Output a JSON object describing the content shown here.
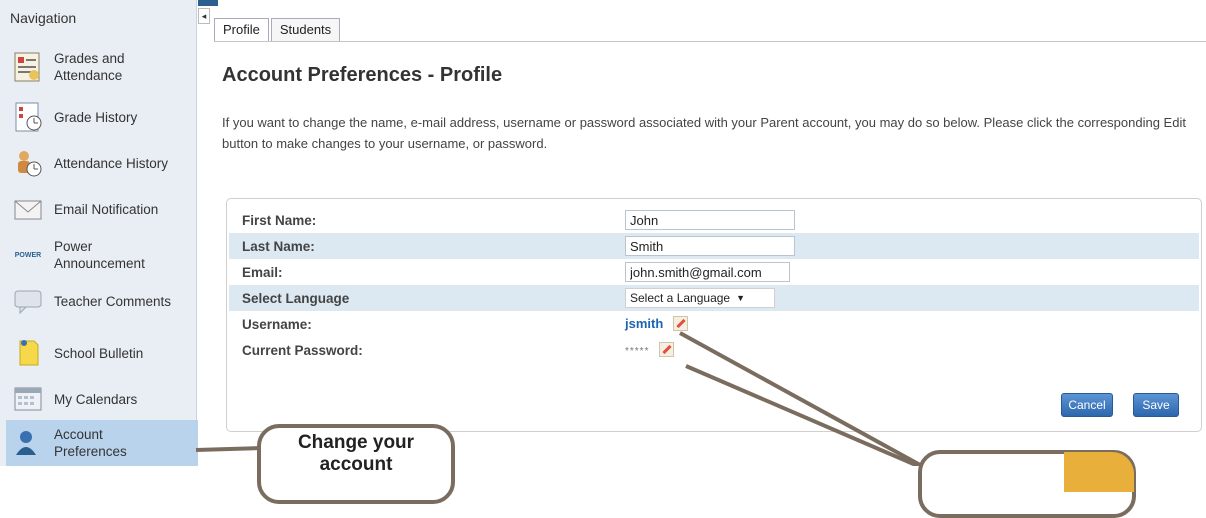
{
  "sidebar": {
    "title": "Navigation",
    "items": [
      {
        "label": "Grades and Attendance",
        "icon": "grades-icon"
      },
      {
        "label": "Grade History",
        "icon": "grade-history-icon"
      },
      {
        "label": "Attendance History",
        "icon": "attendance-history-icon"
      },
      {
        "label": "Email Notification",
        "icon": "email-icon"
      },
      {
        "label": "Power Announcement",
        "icon": "power-announcement-icon",
        "icon_text": "POWER"
      },
      {
        "label": "Teacher Comments",
        "icon": "comments-icon"
      },
      {
        "label": "School Bulletin",
        "icon": "bulletin-icon"
      },
      {
        "label": "My Calendars",
        "icon": "calendar-icon"
      },
      {
        "label": "Account Preferences",
        "icon": "account-icon"
      }
    ]
  },
  "tabs": [
    {
      "label": "Profile",
      "active": true
    },
    {
      "label": "Students",
      "active": false
    }
  ],
  "page": {
    "title": "Account Preferences - Profile",
    "intro": "If you want to change the name, e-mail address, username or password associated with your Parent account, you may do so below. Please click the corresponding Edit button to make changes to your username, or password."
  },
  "form": {
    "first_name_label": "First Name:",
    "first_name": "John",
    "last_name_label": "Last Name:",
    "last_name": "Smith",
    "email_label": "Email:",
    "email": "john.smith@gmail.com",
    "language_label": "Select Language",
    "language": "Select a Language",
    "username_label": "Username:",
    "username": "jsmith",
    "password_label": "Current Password:",
    "password_mask": "*****",
    "cancel_label": "Cancel",
    "save_label": "Save"
  },
  "callout": {
    "text": "Change your account"
  },
  "colors": {
    "accent": "#2d66ac",
    "sidebar_bg": "#e9eef4",
    "row_shade": "#dde9f2",
    "active_nav": "#b9d3ec",
    "callout_border": "#7a6c5e",
    "callout_accent": "#e8b03a"
  }
}
